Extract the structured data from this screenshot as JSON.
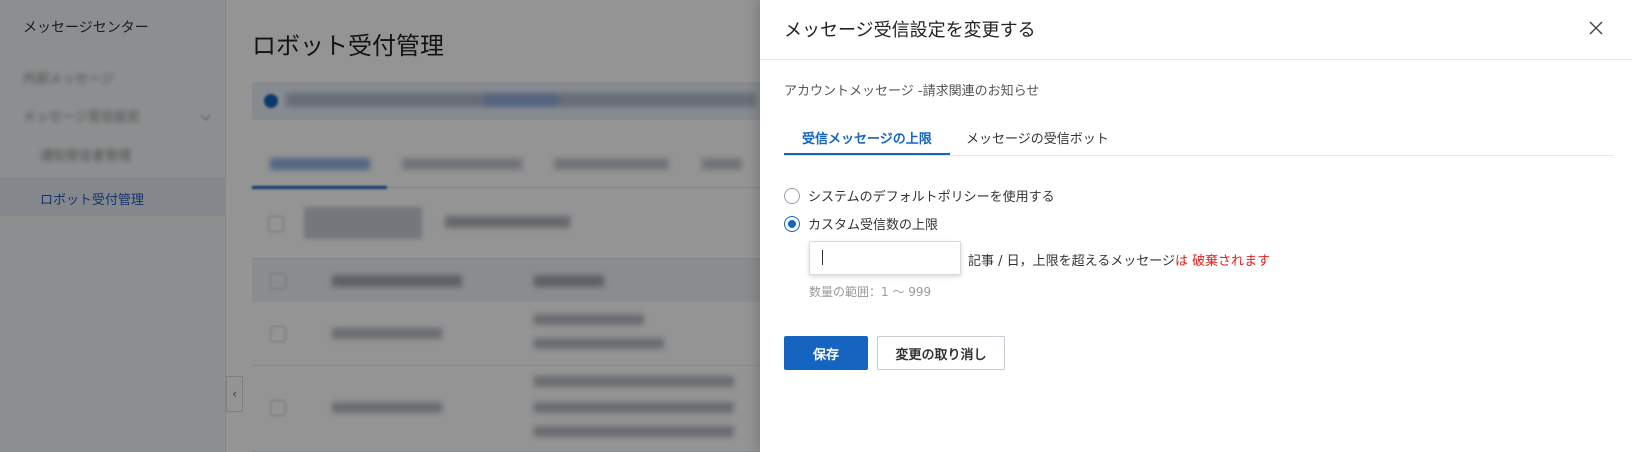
{
  "sidebar": {
    "title": "メッセージセンター",
    "items": [
      {
        "label": "内部メッセージ"
      },
      {
        "label": "メッセージ受信設定"
      },
      {
        "label": "通知受信者管理"
      },
      {
        "label": "ロボット受付管理"
      }
    ]
  },
  "main": {
    "title": "ロボット受付管理"
  },
  "drawer": {
    "title": "メッセージ受信設定を変更する",
    "subtitle": "アカウントメッセージ -請求関連のお知らせ",
    "tabs": [
      {
        "label": "受信メッセージの上限"
      },
      {
        "label": "メッセージの受信ボット"
      }
    ],
    "options": [
      {
        "label": "システムのデフォルトポリシーを使用する",
        "selected": false
      },
      {
        "label": "カスタム受信数の上限",
        "selected": true
      }
    ],
    "quantity": {
      "value": "",
      "unit_text": "記事 / 日，上限を超えるメッセージ",
      "warning_text": "は 破棄されます",
      "range_hint": "数量の範囲：1 〜 999"
    },
    "save_label": "保存",
    "cancel_label": "変更の取り消し"
  },
  "colors": {
    "accent": "#1565c0",
    "danger": "#e02020"
  }
}
